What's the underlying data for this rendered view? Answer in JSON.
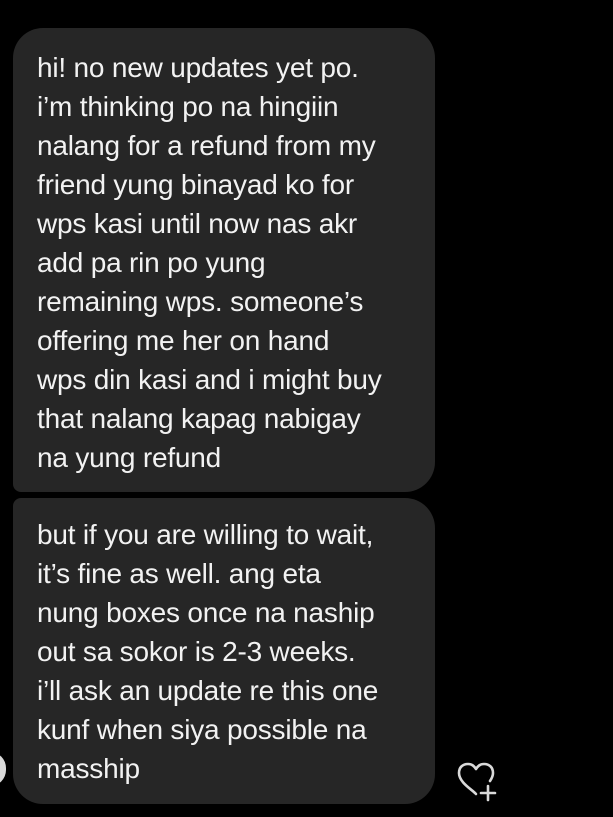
{
  "messages": [
    {
      "text": "hi! no new updates yet po.\ni’m thinking po na hingiin\nnalang for a refund from my\nfriend yung binayad ko for\nwps kasi until now nas akr\nadd pa rin po yung\nremaining wps. someone’s\noffering me her on hand\nwps din kasi and i might buy\nthat nalang kapag nabigay\nna yung refund"
    },
    {
      "text": "but if you are willing to wait,\nit’s fine as well. ang eta\nnung boxes once na naship\nout sa sokor is 2-3 weeks.\ni’ll ask an update re this one\nkunf when siya possible na\nmasship"
    }
  ],
  "icons": {
    "react": "heart-plus-icon",
    "avatar": "avatar"
  },
  "colors": {
    "background": "#000000",
    "bubble": "#262626",
    "text": "#f2f2f2",
    "icon": "#d9d9d9"
  }
}
